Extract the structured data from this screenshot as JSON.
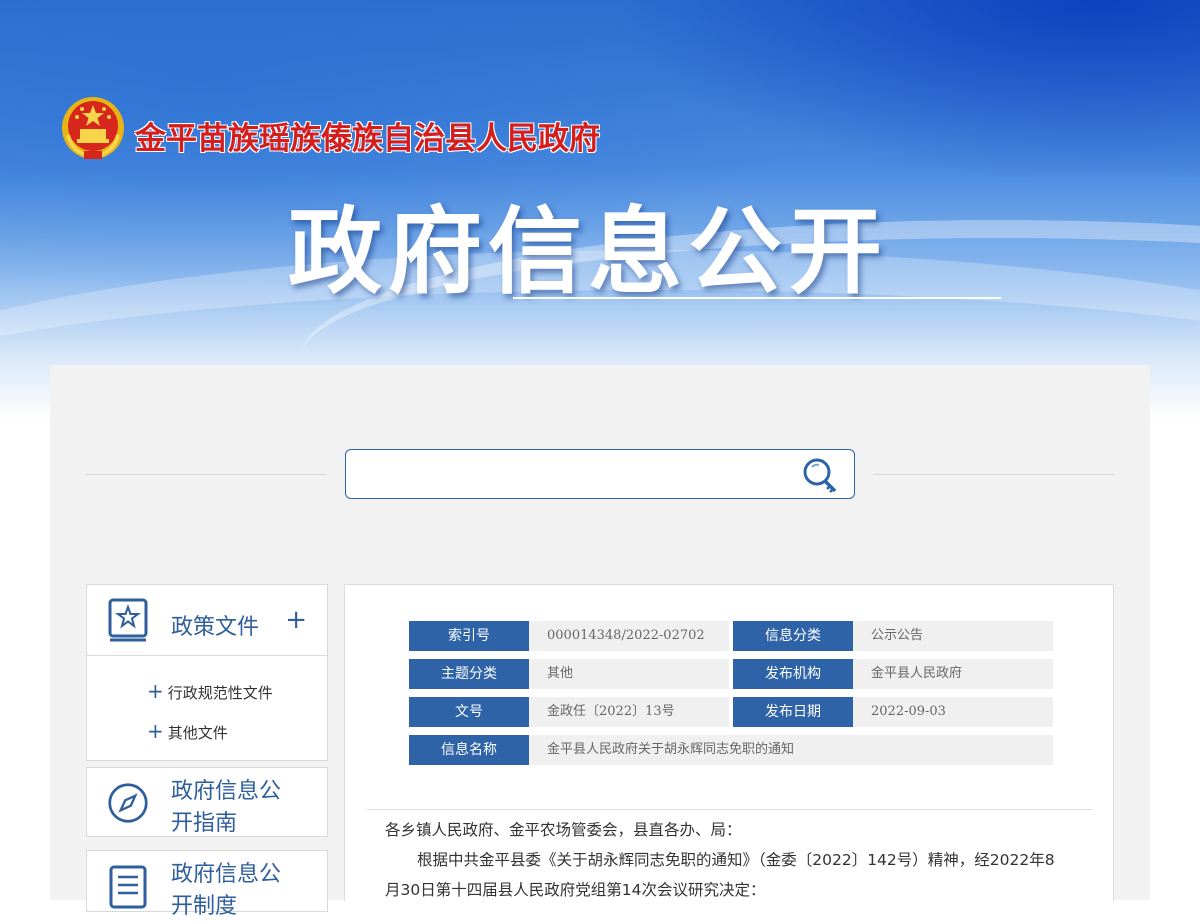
{
  "header": {
    "org_name": "金平苗族瑶族傣族自治县人民政府",
    "big_title": "政府信息公开"
  },
  "search": {
    "placeholder": ""
  },
  "sidebar": {
    "policy_docs": {
      "title": "政策文件",
      "expand": "+",
      "items": [
        {
          "label": "行政规范性文件"
        },
        {
          "label": "其他文件"
        }
      ]
    },
    "guide": {
      "title": "政府信息公开指南"
    },
    "system": {
      "title": "政府信息公开制度"
    }
  },
  "meta": {
    "index_label": "索引号",
    "index_value": "000014348/2022-02702",
    "category_label": "信息分类",
    "category_value": "公示公告",
    "topic_label": "主题分类",
    "topic_value": "其他",
    "publisher_label": "发布机构",
    "publisher_value": "金平县人民政府",
    "docno_label": "文号",
    "docno_value": "金政任〔2022〕13号",
    "date_label": "发布日期",
    "date_value": "2022-09-03",
    "name_label": "信息名称",
    "name_value": "金平县人民政府关于胡永辉同志免职的通知"
  },
  "body": {
    "salutation": "各乡镇人民政府、金平农场管委会，县直各办、局：",
    "para1": "根据中共金平县委《关于胡永辉同志免职的通知》（金委〔2022〕142号）精神，经2022年8月30日第十四届县人民政府党组第14次会议研究决定："
  },
  "colors": {
    "primary": "#2e63a8",
    "red": "#d41d1d",
    "panel": "#f2f2f2"
  },
  "icons": [
    "emblem-icon",
    "search-icon",
    "star-book-icon",
    "compass-icon",
    "document-list-icon",
    "plus-icon"
  ]
}
